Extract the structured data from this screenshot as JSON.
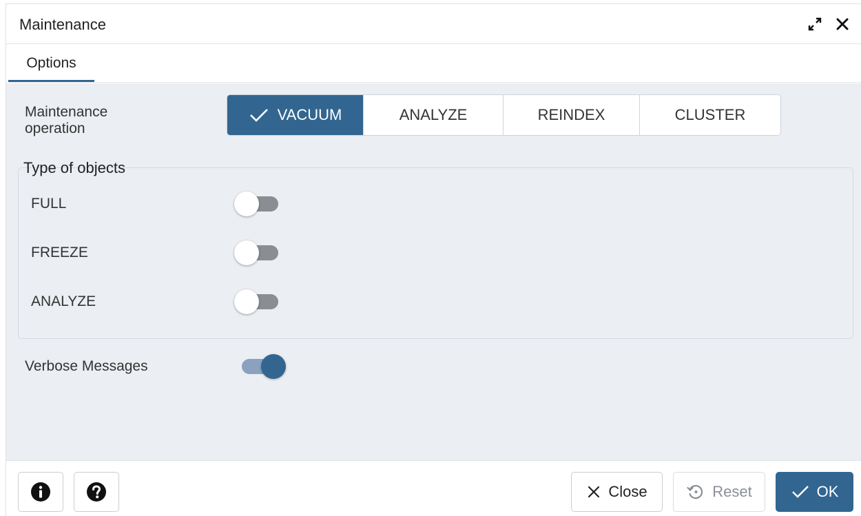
{
  "dialog": {
    "title": "Maintenance",
    "icons": [
      "expand-icon",
      "close-icon"
    ]
  },
  "tabs": [
    {
      "label": "Options",
      "active": true
    }
  ],
  "operation": {
    "label_line1": "Maintenance",
    "label_line2": "operation",
    "options": [
      "VACUUM",
      "ANALYZE",
      "REINDEX",
      "CLUSTER"
    ],
    "selected": "VACUUM"
  },
  "objects": {
    "legend": "Type of objects",
    "toggles": [
      {
        "label": "FULL",
        "on": false
      },
      {
        "label": "FREEZE",
        "on": false
      },
      {
        "label": "ANALYZE",
        "on": false
      }
    ]
  },
  "verbose": {
    "label": "Verbose Messages",
    "on": true
  },
  "footer": {
    "info_icon": "info-icon",
    "help_icon": "help-icon",
    "close_label": "Close",
    "reset_label": "Reset",
    "ok_label": "OK"
  },
  "colors": {
    "accent": "#326690",
    "content_bg": "#ebeef3",
    "toggle_off_track": "#8a8d92",
    "toggle_on_track": "#8aa2bf"
  }
}
